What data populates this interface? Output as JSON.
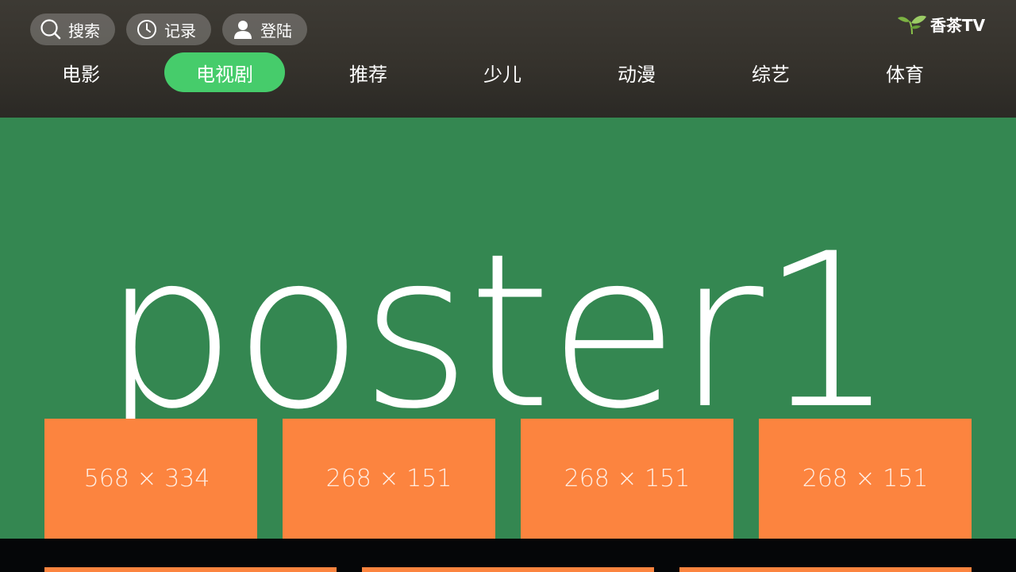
{
  "header": {
    "buttons": [
      {
        "label": "搜索",
        "icon": "search-icon"
      },
      {
        "label": "记录",
        "icon": "clock-icon"
      },
      {
        "label": "登陆",
        "icon": "user-icon"
      }
    ],
    "brand": {
      "name": "香茶TV",
      "icon": "tea-leaf-icon"
    }
  },
  "nav": {
    "tabs": [
      {
        "label": "电影",
        "active": false
      },
      {
        "label": "电视剧",
        "active": true
      },
      {
        "label": "推荐",
        "active": false
      },
      {
        "label": "少儿",
        "active": false
      },
      {
        "label": "动漫",
        "active": false
      },
      {
        "label": "综艺",
        "active": false
      },
      {
        "label": "体育",
        "active": false
      }
    ]
  },
  "hero": {
    "label": "poster1"
  },
  "tiles": [
    {
      "label": "568 × 334"
    },
    {
      "label": "268 × 151"
    },
    {
      "label": "268 × 151"
    },
    {
      "label": "268 × 151"
    }
  ],
  "colors": {
    "header_bg": "#3b3832",
    "active_tab": "#46cc6b",
    "hero_bg": "#348751",
    "tile_bg": "#fc843f",
    "bottom_bg": "#050608"
  }
}
